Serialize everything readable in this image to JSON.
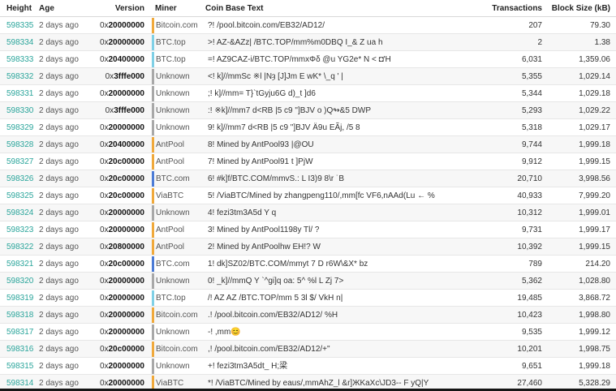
{
  "table": {
    "headers": {
      "height": "Height",
      "age": "Age",
      "version": "Version",
      "miner": "Miner",
      "coinbase": "Coin Base Text",
      "transactions": "Transactions",
      "size": "Block Size (kB)"
    },
    "rows": [
      {
        "height": "598335",
        "age": "2 days ago",
        "version_prefix": "0x",
        "version": "20000000",
        "miner": "Bitcoin.com",
        "miner_color": "#f0a93b",
        "coinbase": "?! /pool.bitcoin.com/EB32/AD12/",
        "transactions": "207",
        "size": "79.30"
      },
      {
        "height": "598334",
        "age": "2 days ago",
        "version_prefix": "0x",
        "version": "20000000",
        "miner": "BTC.top",
        "miner_color": "#7fd0e6",
        "coinbase": ">! AZ-&AZz| /BTC.TOP/mm%m0DBQ I_& Z ua h",
        "transactions": "2",
        "size": "1.38"
      },
      {
        "height": "598333",
        "age": "2 days ago",
        "version_prefix": "0x",
        "version": "20400000",
        "miner": "BTC.top",
        "miner_color": "#7fd0e6",
        "coinbase": "=! AZ9CAZ-i/BTC.TOP/mmxΦδ @u YG2e* N  < ◘'H",
        "transactions": "6,031",
        "size": "1,359.06"
      },
      {
        "height": "598332",
        "age": "2 days ago",
        "version_prefix": "0x",
        "version": "3fffe000",
        "miner": "Unknown",
        "miner_color": "#a8a8a8",
        "coinbase": "<!  k]//mmSc ※l |Nȝ [J]Jm E wK* \\_q ' |",
        "transactions": "5,355",
        "size": "1,029.14"
      },
      {
        "height": "598331",
        "age": "2 days ago",
        "version_prefix": "0x",
        "version": "20000000",
        "miner": "Unknown",
        "miner_color": "#a8a8a8",
        "coinbase": ";!  k]//mm= T}`tGyju6G  d)_t ]d6",
        "transactions": "5,344",
        "size": "1,029.18"
      },
      {
        "height": "598330",
        "age": "2 days ago",
        "version_prefix": "0x",
        "version": "3fffe000",
        "miner": "Unknown",
        "miner_color": "#a8a8a8",
        "coinbase": ":!  ※k]//mm7 d<RB |5 c9 \"]BJV o )Q↬&5 DWP",
        "transactions": "5,293",
        "size": "1,029.22"
      },
      {
        "height": "598329",
        "age": "2 days ago",
        "version_prefix": "0x",
        "version": "20000000",
        "miner": "Unknown",
        "miner_color": "#a8a8a8",
        "coinbase": "9!  k]//mm7 d<RB |5 c9 \"]BJV Ä9u EÃj,  /5 8",
        "transactions": "5,318",
        "size": "1,029.17"
      },
      {
        "height": "598328",
        "age": "2 days ago",
        "version_prefix": "0x",
        "version": "20400000",
        "miner": "AntPool",
        "miner_color": "#f0a93b",
        "coinbase": "8!  Mined by AntPool93 |@OU",
        "transactions": "9,744",
        "size": "1,999.18"
      },
      {
        "height": "598327",
        "age": "2 days ago",
        "version_prefix": "0x",
        "version": "20c00000",
        "miner": "AntPool",
        "miner_color": "#f0a93b",
        "coinbase": "7!  Mined by AntPool91 t ]PjW",
        "transactions": "9,912",
        "size": "1,999.15"
      },
      {
        "height": "598326",
        "age": "2 days ago",
        "version_prefix": "0x",
        "version": "20c00000",
        "miner": "BTC.com",
        "miner_color": "#4b7bd6",
        "coinbase": "6!  #k]f/BTC.COM/mmvS.:  L I3)9   8\\r ˙B",
        "transactions": "20,710",
        "size": "3,998.56"
      },
      {
        "height": "598325",
        "age": "2 days ago",
        "version_prefix": "0x",
        "version": "20c00000",
        "miner": "ViaBTC",
        "miner_color": "#f0a93b",
        "coinbase": "5!  /ViaBTC/Mined by zhangpeng110/,mm[fc   VF6,nAAd(Lu  ←  %",
        "transactions": "40,933",
        "size": "7,999.20"
      },
      {
        "height": "598324",
        "age": "2 days ago",
        "version_prefix": "0x",
        "version": "20000000",
        "miner": "Unknown",
        "miner_color": "#a8a8a8",
        "coinbase": "4! fezi3tm3A5d Y q",
        "transactions": "10,312",
        "size": "1,999.01"
      },
      {
        "height": "598323",
        "age": "2 days ago",
        "version_prefix": "0x",
        "version": "20000000",
        "miner": "AntPool",
        "miner_color": "#f0a93b",
        "coinbase": "3!  Mined by AntPool1198y Tl/ ?",
        "transactions": "9,731",
        "size": "1,999.17"
      },
      {
        "height": "598322",
        "age": "2 days ago",
        "version_prefix": "0x",
        "version": "20800000",
        "miner": "AntPool",
        "miner_color": "#f0a93b",
        "coinbase": "2!  Mined by AntPoolhw  EH!?  W",
        "transactions": "10,392",
        "size": "1,999.15"
      },
      {
        "height": "598321",
        "age": "2 days ago",
        "version_prefix": "0x",
        "version": "20c00000",
        "miner": "BTC.com",
        "miner_color": "#4b7bd6",
        "coinbase": "1!  dk]SZ02/BTC.COM/mmyt 7 D r6W\\&X*  bz",
        "transactions": "789",
        "size": "214.20"
      },
      {
        "height": "598320",
        "age": "2 days ago",
        "version_prefix": "0x",
        "version": "20000000",
        "miner": "Unknown",
        "miner_color": "#a8a8a8",
        "coinbase": "0!  _k]//mmQ  Y   `^gi]q oa:  5^ %l  L  Zj  7>",
        "transactions": "5,362",
        "size": "1,028.80"
      },
      {
        "height": "598319",
        "age": "2 days ago",
        "version_prefix": "0x",
        "version": "20000000",
        "miner": "BTC.top",
        "miner_color": "#7fd0e6",
        "coinbase": "/! AZ  AZ  /BTC.TOP/mm  5 3l $/ VkH n|",
        "transactions": "19,485",
        "size": "3,868.72"
      },
      {
        "height": "598318",
        "age": "2 days ago",
        "version_prefix": "0x",
        "version": "20000000",
        "miner": "Bitcoin.com",
        "miner_color": "#f0a93b",
        "coinbase": ".! /pool.bitcoin.com/EB32/AD12/   %H",
        "transactions": "10,423",
        "size": "1,998.80"
      },
      {
        "height": "598317",
        "age": "2 days ago",
        "version_prefix": "0x",
        "version": "20000000",
        "miner": "Unknown",
        "miner_color": "#a8a8a8",
        "coinbase": "-! ,mm😊",
        "transactions": "9,535",
        "size": "1,999.12"
      },
      {
        "height": "598316",
        "age": "2 days ago",
        "version_prefix": "0x",
        "version": "20c00000",
        "miner": "Bitcoin.com",
        "miner_color": "#f0a93b",
        "coinbase": ",! /pool.bitcoin.com/EB32/AD12/+\"",
        "transactions": "10,201",
        "size": "1,998.75"
      },
      {
        "height": "598315",
        "age": "2 days ago",
        "version_prefix": "0x",
        "version": "20000000",
        "miner": "Unknown",
        "miner_color": "#a8a8a8",
        "coinbase": "+! fezi3tm3A5dt_   H;梁",
        "transactions": "9,651",
        "size": "1,999.18"
      },
      {
        "height": "598314",
        "age": "2 days ago",
        "version_prefix": "0x",
        "version": "20000000",
        "miner": "ViaBTC",
        "miner_color": "#f0a93b",
        "coinbase": "*!  /ViaBTC/Mined by eaus/,mmAhZ_l &r]ЖKaXc\\JD3--  F yQ|Y",
        "transactions": "27,460",
        "size": "5,328.29"
      }
    ]
  }
}
